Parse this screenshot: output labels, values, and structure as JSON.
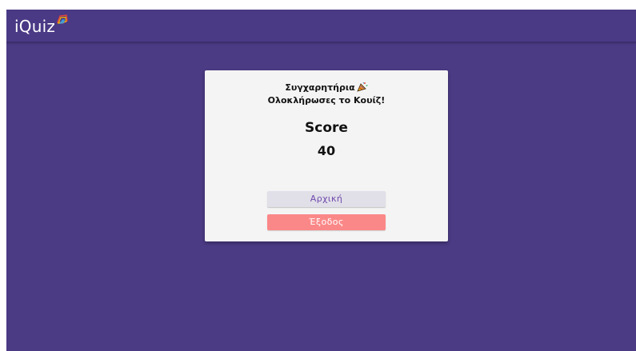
{
  "app": {
    "brand": "iQuiz",
    "logo_icon": "quiz-logo-icon"
  },
  "result": {
    "congrats_line1": "Συγχαρητήρια",
    "congrats_icon": "party-popper-icon",
    "congrats_line2": "Ολοκλήρωσες το Κουίζ!",
    "score_label": "Score",
    "score_value": "40"
  },
  "actions": {
    "home_label": "Αρχική",
    "exit_label": "Έξοδος"
  },
  "colors": {
    "background": "#4b3a84",
    "card": "#f4f4f4",
    "home_button": "#e1dfe8",
    "home_text": "#6f4aad",
    "exit_button": "#fb8888"
  }
}
